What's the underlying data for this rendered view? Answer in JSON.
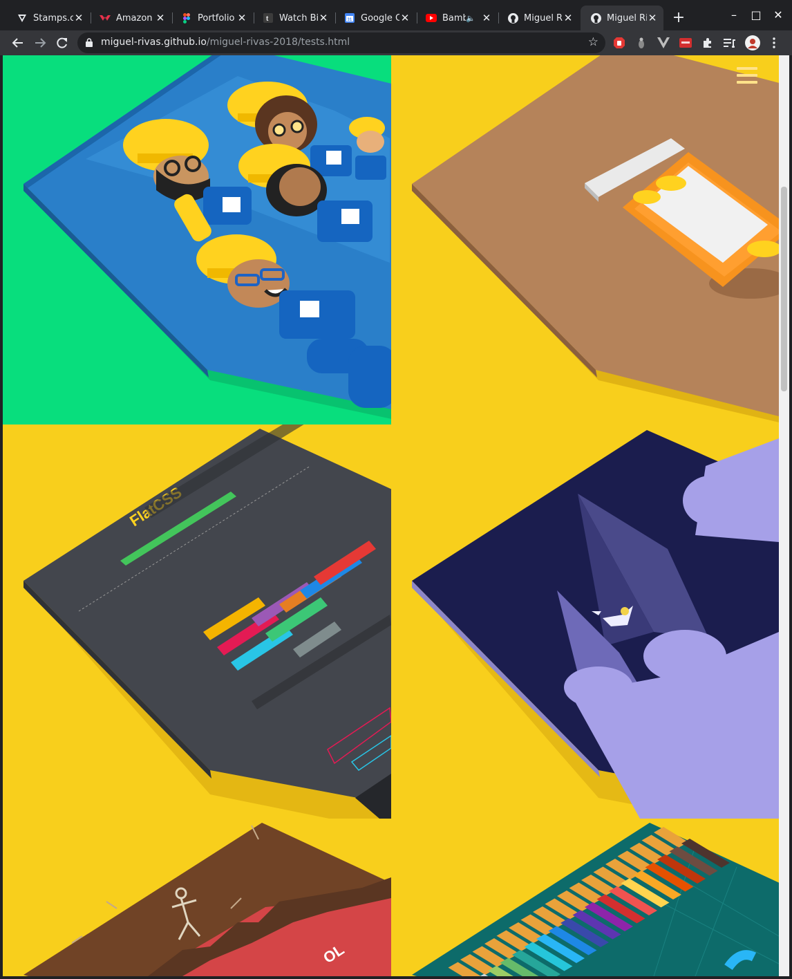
{
  "browser": {
    "tabs": [
      {
        "title": "Stamps.co",
        "favicon": "stamps-icon",
        "active": false
      },
      {
        "title": "Amazon B",
        "favicon": "amazon-icon",
        "active": false
      },
      {
        "title": "Portfolio",
        "favicon": "figma-icon",
        "active": false
      },
      {
        "title": "Watch Bi",
        "favicon": "tumblr-icon",
        "active": false
      },
      {
        "title": "Google C",
        "favicon": "calendar-icon",
        "active": false
      },
      {
        "title": "Bamb",
        "favicon": "youtube-icon",
        "active": false,
        "audio": true
      },
      {
        "title": "Miguel Ri",
        "favicon": "github-icon",
        "active": false
      },
      {
        "title": "Miguel Ri",
        "favicon": "github-icon",
        "active": true
      }
    ],
    "new_tab": "+",
    "window_controls": {
      "minimize": "–",
      "maximize": "□",
      "close": "✕"
    },
    "url_host": "miguel-rivas.github.io",
    "url_path": "/miguel-rivas-2018/tests.html",
    "colors": {
      "page_background": "#f8cf1c",
      "chrome_dark": "#202124",
      "chrome_toolbar": "#35363a"
    }
  },
  "page": {
    "menu_icon": "hamburger-icon",
    "gallery": [
      {
        "name": "construction-workers",
        "background": "#08de7d"
      },
      {
        "name": "pill-bottle",
        "background": "#f8cf1c"
      },
      {
        "name": "flatcss",
        "background": "#f8cf1c",
        "heading": "FlatCSS"
      },
      {
        "name": "mountain-bird",
        "background": "#f8cf1c"
      },
      {
        "name": "skeleton-dig",
        "background": "#f8cf1c",
        "fragment": "OL"
      },
      {
        "name": "color-pencils",
        "background": "#f8cf1c"
      }
    ]
  }
}
